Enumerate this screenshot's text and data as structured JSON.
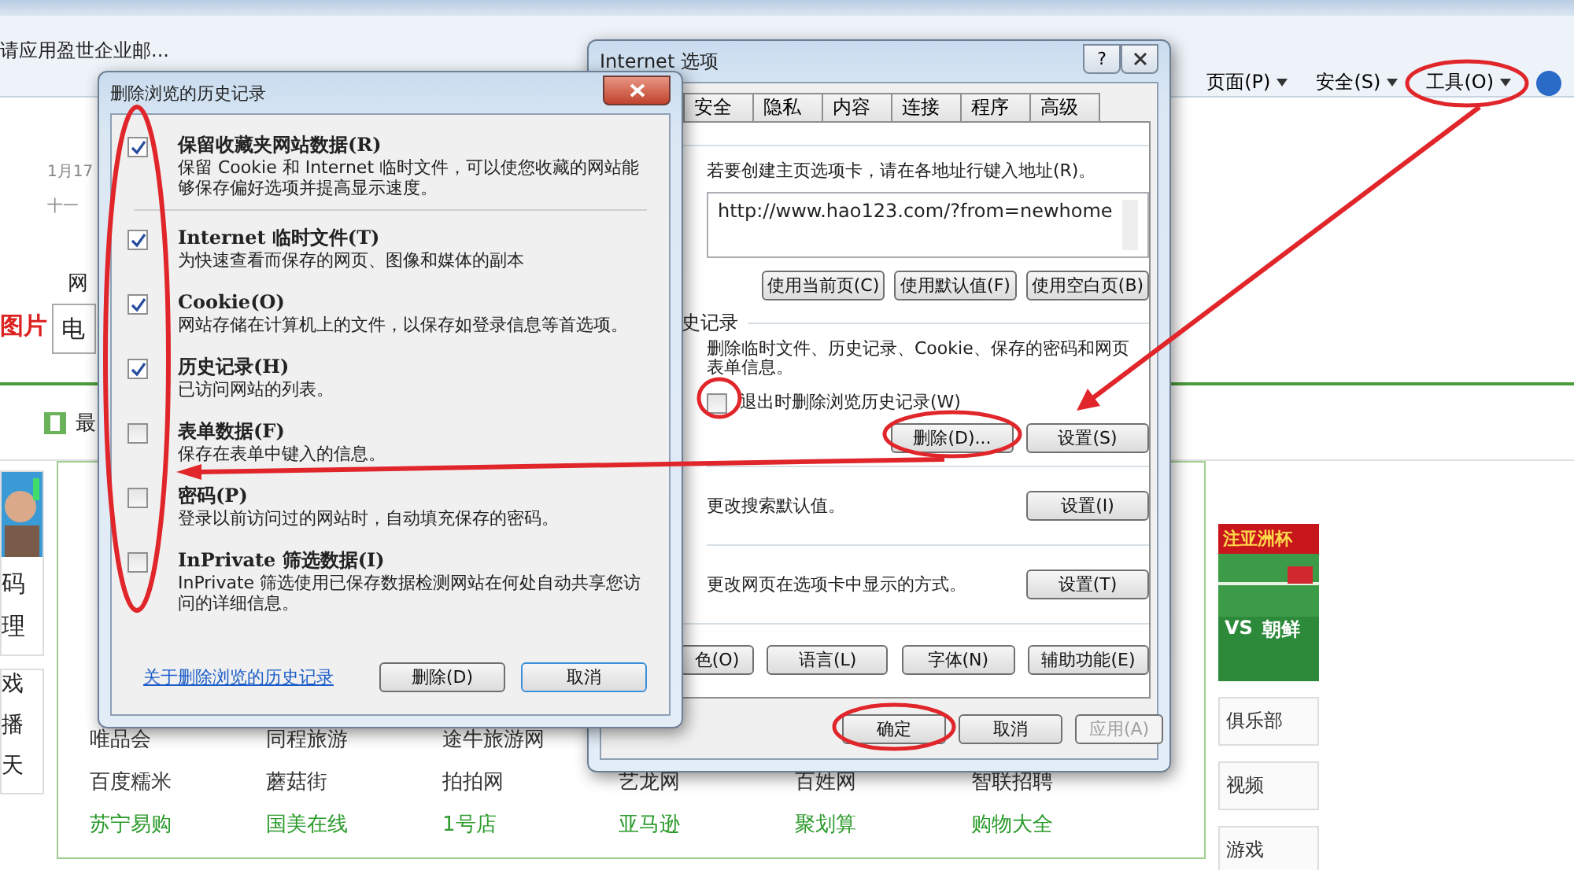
{
  "browser": {
    "favorites_item": "请应用盈世企业邮...",
    "commands": [
      {
        "label": "页面(P)"
      },
      {
        "label": "安全(S)"
      },
      {
        "label": "工具(O)"
      }
    ]
  },
  "page": {
    "date": "1月17",
    "lunar": "十一",
    "search_label": "网",
    "image_tab": "图片",
    "search_value": "电",
    "section_title": "最",
    "profile_lines": [
      "码",
      "理"
    ],
    "game_lines": [
      "戏",
      "播",
      "天"
    ],
    "link_rows": [
      {
        "green": false,
        "items": [
          "唯品会",
          "同程旅游",
          "途牛旅游网"
        ]
      },
      {
        "green": false,
        "items": [
          "百度糯米",
          "蘑菇街",
          "拍拍网",
          "艺龙网",
          "百姓网",
          "智联招聘"
        ]
      },
      {
        "green": true,
        "items": [
          "苏宁易购",
          "国美在线",
          "1号店",
          "亚马逊",
          "聚划算",
          "购物大全"
        ]
      }
    ],
    "banner": {
      "title": "注亚洲杯",
      "vs": "VS",
      "team": "朝鲜"
    },
    "sidebar": [
      "俱乐部",
      "视频",
      "游戏"
    ]
  },
  "history_dialog": {
    "title": "删除浏览的历史记录",
    "options": [
      {
        "label": "保留收藏夹网站数据(R)",
        "desc": "保留 Cookie 和 Internet 临时文件，可以使您收藏的网站能够保存偏好选项并提高显示速度。",
        "checked": true
      },
      {
        "label": "Internet 临时文件(T)",
        "desc": "为快速查看而保存的网页、图像和媒体的副本",
        "checked": true
      },
      {
        "label": "Cookie(O)",
        "desc": "网站存储在计算机上的文件，以保存如登录信息等首选项。",
        "checked": true
      },
      {
        "label": "历史记录(H)",
        "desc": "已访问网站的列表。",
        "checked": true
      },
      {
        "label": "表单数据(F)",
        "desc": "保存在表单中键入的信息。",
        "checked": false
      },
      {
        "label": "密码(P)",
        "desc": "登录以前访问过的网站时，自动填充保存的密码。",
        "checked": false
      },
      {
        "label": "InPrivate 筛选数据(I)",
        "desc": "InPrivate 筛选使用已保存数据检测网站在何处自动共享您访问的详细信息。",
        "checked": false
      }
    ],
    "link": "关于删除浏览的历史记录",
    "buttons": [
      {
        "label": "删除(D)",
        "focused": false
      },
      {
        "label": "取消",
        "focused": true
      }
    ]
  },
  "options_dialog": {
    "title": "Internet 选项",
    "help_glyph": "?",
    "tabs": [
      {
        "label": "安全",
        "selected": false
      },
      {
        "label": "隐私",
        "selected": false
      },
      {
        "label": "内容",
        "selected": false
      },
      {
        "label": "连接",
        "selected": false
      },
      {
        "label": "程序",
        "selected": false
      },
      {
        "label": "高级",
        "selected": false
      }
    ],
    "home_hint": "若要创建主页选项卡，请在各地址行键入地址(R)。",
    "home_url": "http://www.hao123.com/?from=newhome",
    "home_buttons": [
      "使用当前页(C)",
      "使用默认值(F)",
      "使用空白页(B)"
    ],
    "history_header": "史记录",
    "history_text": "删除临时文件、历史记录、Cookie、保存的密码和网页表单信息。",
    "exit_delete": {
      "label": "退出时删除浏览历史记录(W)",
      "checked": false
    },
    "history_buttons": [
      "删除(D)...",
      "设置(S)"
    ],
    "search_text": "更改搜索默认值。",
    "search_button": "设置(I)",
    "tabs_text": "更改网页在选项卡中显示的方式。",
    "tabs_button": "设置(T)",
    "appearance_buttons": [
      "色(O)",
      "语言(L)",
      "字体(N)",
      "辅助功能(E)"
    ],
    "footer_buttons": [
      {
        "label": "确定",
        "disabled": false
      },
      {
        "label": "取消",
        "disabled": false
      },
      {
        "label": "应用(A)",
        "disabled": true
      }
    ]
  }
}
